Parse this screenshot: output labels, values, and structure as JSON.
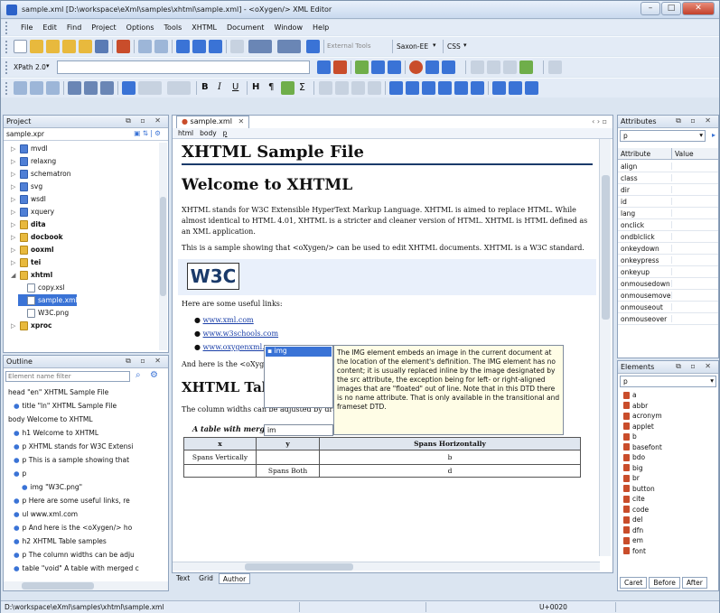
{
  "window": {
    "title": "sample.xml [D:\\workspace\\eXml\\samples\\xhtml\\sample.xml] - <oXygen/> XML Editor",
    "min": "–",
    "max": "□",
    "close": "✕"
  },
  "menu": [
    "File",
    "Edit",
    "Find",
    "Project",
    "Options",
    "Tools",
    "XHTML",
    "Document",
    "Window",
    "Help"
  ],
  "toolbar": {
    "xpath_label": "XPath 2.0",
    "external_tools": "External Tools",
    "saxon": "Saxon-EE",
    "css": "CSS"
  },
  "project": {
    "header": "Project",
    "file": "sample.xpr",
    "items": [
      {
        "label": "mvdl",
        "indent": 1,
        "color": "blue"
      },
      {
        "label": "relaxng",
        "indent": 1,
        "color": "blue"
      },
      {
        "label": "schematron",
        "indent": 1,
        "color": "blue"
      },
      {
        "label": "svg",
        "indent": 1,
        "color": "blue"
      },
      {
        "label": "wsdl",
        "indent": 1,
        "color": "blue"
      },
      {
        "label": "xquery",
        "indent": 1,
        "color": "blue"
      },
      {
        "label": "dita",
        "indent": 1,
        "color": "yellow"
      },
      {
        "label": "docbook",
        "indent": 1,
        "color": "yellow"
      },
      {
        "label": "ooxml",
        "indent": 1,
        "color": "yellow"
      },
      {
        "label": "tei",
        "indent": 1,
        "color": "yellow"
      },
      {
        "label": "xhtml",
        "indent": 1,
        "color": "yellow"
      },
      {
        "label": "copy.xsl",
        "indent": 2,
        "color": "file"
      },
      {
        "label": "sample.xml",
        "indent": 2,
        "color": "sel"
      },
      {
        "label": "W3C.png",
        "indent": 2,
        "color": "file"
      },
      {
        "label": "xproc",
        "indent": 1,
        "color": "yellow"
      }
    ]
  },
  "outline": {
    "header": "Outline",
    "filter_placeholder": "Element name filter",
    "items": [
      {
        "label": "head \"en\" XHTML Sample File",
        "indent": 0
      },
      {
        "label": "title \"ln\" XHTML Sample File",
        "indent": 1
      },
      {
        "label": "body  Welcome to XHTML",
        "indent": 0
      },
      {
        "label": "h1  Welcome to XHTML",
        "indent": 1
      },
      {
        "label": "p  XHTML stands for W3C Extensi",
        "indent": 1
      },
      {
        "label": "p  This is a sample showing that",
        "indent": 1
      },
      {
        "label": "p",
        "indent": 1
      },
      {
        "label": "img  \"W3C.png\"",
        "indent": 2
      },
      {
        "label": "p  Here are some useful links, re",
        "indent": 1
      },
      {
        "label": "ul  www.xml.com",
        "indent": 1
      },
      {
        "label": "p  And here is the <oXygen/> ho",
        "indent": 1
      },
      {
        "label": "h2  XHTML Table samples",
        "indent": 1
      },
      {
        "label": "p  The column widths can be adju",
        "indent": 1
      },
      {
        "label": "table  \"void\" A table with merged c",
        "indent": 1
      }
    ]
  },
  "editor": {
    "tab": "sample.xml",
    "breadcrumb": [
      "html",
      "body",
      "p"
    ],
    "title": "XHTML Sample File",
    "h1": "Welcome to XHTML",
    "p1": "XHTML stands for W3C Extensible HyperText Markup Language. XHTML is aimed to replace HTML. While almost identical to HTML 4.01, XHTML is a stricter and cleaner version of HTML. XHTML is HTML defined as an XML application.",
    "p2": "This is a sample showing that <oXygen/> can be used to edit XHTML documents. XHTML is a W3C standard.",
    "w3c": "W3C",
    "p3": "Here are some useful links:",
    "links": [
      "www.xml.com",
      "www.w3schools.com",
      "www.oxygenxml.com"
    ],
    "p4": "And here is the <oXygen/> home page: http://www.oxygenxml.com",
    "h2": "XHTML Table samples",
    "p5": "The column widths can be adjusted by dragging the column margins.",
    "caption": "A table with merged cells, fixed column widths and fixed total width.",
    "table_head": [
      "x",
      "y",
      "Spans Horizontally"
    ],
    "table_row1": [
      "Spans Vertically",
      "",
      "b"
    ],
    "table_row2": [
      "",
      "Spans Both",
      "d"
    ]
  },
  "popup": {
    "item": "img",
    "desc": "The IMG element embeds an image in the current document at the location of the element's definition. The IMG element has no content; it is usually replaced inline by the image designated by the src attribute, the exception being for left- or right-aligned images that are \"floated\" out of line. Note that in this DTD there is no name attribute. That is only available in the transitional and frameset DTD.",
    "input": "im"
  },
  "bottom_tabs": [
    "Text",
    "Grid",
    "Author"
  ],
  "attributes": {
    "header": "Attributes",
    "combo": "p",
    "col1": "Attribute",
    "col2": "Value",
    "rows": [
      "align",
      "class",
      "dir",
      "id",
      "lang",
      "onclick",
      "ondblclick",
      "onkeydown",
      "onkeypress",
      "onkeyup",
      "onmousedown",
      "onmousemove",
      "onmouseout",
      "onmouseover"
    ]
  },
  "elements": {
    "header": "Elements",
    "combo": "p",
    "items": [
      "a",
      "abbr",
      "acronym",
      "applet",
      "b",
      "basefont",
      "bdo",
      "big",
      "br",
      "button",
      "cite",
      "code",
      "del",
      "dfn",
      "em",
      "font"
    ],
    "tabs": [
      "Caret",
      "Before",
      "After"
    ]
  },
  "status": {
    "path": "D:\\workspace\\eXml\\samples\\xhtml\\sample.xml",
    "code": "U+0020"
  },
  "colors": {
    "accent": "#2b62c9",
    "selection": "#3a73d6",
    "heading_rule": "#1a3a6a"
  }
}
